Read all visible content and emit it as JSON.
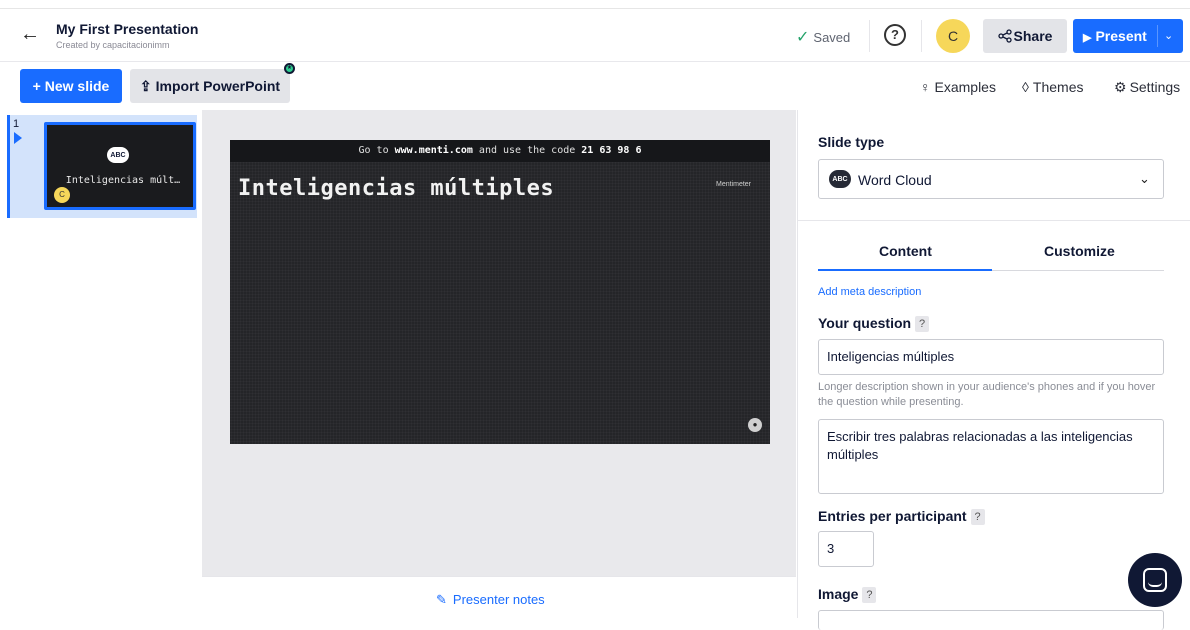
{
  "header": {
    "title": "My First Presentation",
    "subtitle": "Created by capacitacionimm",
    "saved_label": "Saved",
    "help_label": "?",
    "avatar_initial": "C",
    "share_label": "Share",
    "present_label": "Present"
  },
  "toolbar": {
    "new_slide_label": "+ New slide",
    "import_label": "Import PowerPoint",
    "examples_label": "Examples",
    "themes_label": "Themes",
    "settings_label": "Settings"
  },
  "slides_list": {
    "items": [
      {
        "number": "1",
        "icon_text": "ABC",
        "title": "Inteligencias múlt…",
        "avatar_initial": "C"
      }
    ]
  },
  "slide": {
    "top_bar_prefix": "Go to ",
    "top_bar_site": "www.menti.com",
    "top_bar_middle": " and use the code ",
    "top_bar_code": "21 63 98 6",
    "title": "Inteligencias múltiples",
    "brand": "Mentimeter"
  },
  "notes": {
    "label": "Presenter notes"
  },
  "editor": {
    "slide_type_label": "Slide type",
    "slide_type_icon_text": "ABC",
    "slide_type_value": "Word Cloud",
    "tabs": [
      {
        "label": "Content",
        "active": true
      },
      {
        "label": "Customize",
        "active": false
      }
    ],
    "meta_link": "Add meta description",
    "question_label": "Your question",
    "question_value": "Inteligencias múltiples",
    "description_help": "Longer description shown in your audience's phones and if you hover the question while presenting.",
    "description_value": "Escribir tres palabras relacionadas a las inteligencias múltiples",
    "entries_label": "Entries per participant",
    "entries_value": "3",
    "image_label": "Image",
    "help_mark": "?"
  },
  "colors": {
    "accent": "#196cff",
    "saved_check": "#25a36b",
    "avatar": "#f6d75a",
    "chat": "#101834"
  }
}
